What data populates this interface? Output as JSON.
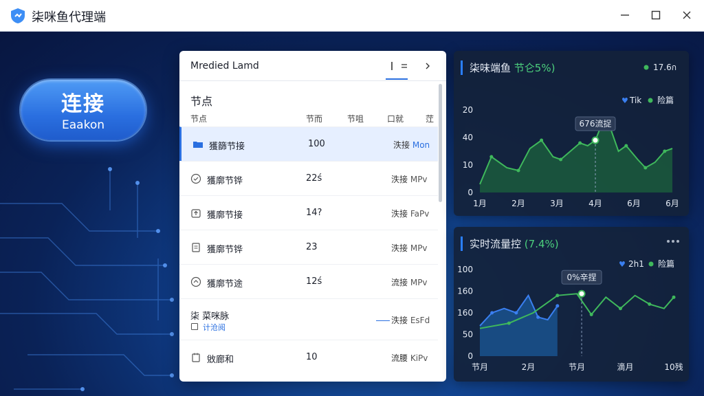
{
  "app": {
    "title": "柒咪鱼代理端",
    "icon": "shield-app-icon"
  },
  "window_controls": {
    "minimize": "minimize-icon",
    "maximize": "maximize-icon",
    "close": "close-icon"
  },
  "connect": {
    "label": "连接",
    "sublabel": "Eaakon"
  },
  "node_panel": {
    "title": "Mredied Lamd",
    "tab_icons": [
      "list-icon",
      "menu-icon",
      "chevron-right-icon"
    ],
    "section_title": "节点",
    "columns": [
      "节点",
      "节而",
      "节咀",
      "口就",
      "茳"
    ],
    "rows": [
      {
        "icon": "folder-icon",
        "name": "獲篩节接",
        "value": "100",
        "status": "泆接",
        "status_extra": "Mon"
      },
      {
        "icon": "check-circle-icon",
        "name": "獲廓节铧",
        "value": "22ś",
        "status": "泆接",
        "status_extra": "MPv"
      },
      {
        "icon": "upload-icon",
        "name": "獲廓节接",
        "value": "14?",
        "status": "泆接",
        "status_extra": "FaPv"
      },
      {
        "icon": "document-icon",
        "name": "獲廓节铧",
        "value": "23",
        "status": "泆接",
        "status_extra": "MPv"
      },
      {
        "icon": "refresh-icon",
        "name": "獲廓节途",
        "value": "12ś",
        "status": "流接",
        "status_extra": "MPv"
      },
      {
        "icon": "tag-icon",
        "name": "柒 菜咪脉",
        "name_sub": "计沧阅",
        "value": "",
        "status": "泆接",
        "status_extra": "EsFd"
      },
      {
        "icon": "calendar-icon",
        "name": "敓廊和",
        "value": "10",
        "status": "流腰",
        "status_extra": "KiPv"
      }
    ]
  },
  "chart_top": {
    "title": "柒味端鱼",
    "pct": "节仑5%)",
    "legend_top": "17.6ก",
    "tooltip": "676流捉",
    "legend_series": [
      "Tik",
      "险篇"
    ],
    "colors": {
      "line": "#3fb85c",
      "fill": "#1f7a3c"
    }
  },
  "chart_bottom": {
    "title": "实时流量控",
    "pct": "(7.4%)",
    "more": "more-icon",
    "tooltip": "0%辛捏",
    "legend_series": [
      "2h1",
      "险篇"
    ],
    "colors": {
      "blue": "#3a7ff0",
      "green": "#3fb85c"
    }
  },
  "chart_data": [
    {
      "type": "area",
      "title": "柒味端鱼 节仑5%)",
      "categories": [
        "1月",
        "2月",
        "3月",
        "4月",
        "6月",
        "6月"
      ],
      "yticks": [
        "0",
        "10",
        "40",
        "20"
      ],
      "ylim": [
        0,
        30
      ],
      "series": [
        {
          "x": [
            0,
            0.3,
            0.7,
            1.0,
            1.3,
            1.6,
            1.9,
            2.1,
            2.35,
            2.6,
            2.8,
            3.0,
            3.2,
            3.4,
            3.6,
            3.8,
            4.1,
            4.3,
            4.55,
            4.8,
            5.0
          ],
          "values": [
            3,
            13,
            9,
            8,
            16,
            19,
            13,
            12,
            15,
            18,
            17,
            19,
            26,
            23,
            15,
            17,
            12,
            9,
            11,
            15,
            16
          ]
        }
      ],
      "highlight": {
        "x": 3.0,
        "y": 19
      }
    },
    {
      "type": "line",
      "title": "实时流量控 (7.4%)",
      "categories": [
        "节月",
        "2月",
        "节月",
        "滴月",
        "10残"
      ],
      "yticks": [
        "0",
        "50",
        "160",
        "160",
        "100"
      ],
      "ylim": [
        0,
        100
      ],
      "series": [
        {
          "name": "2h1",
          "x": [
            0,
            0.25,
            0.5,
            0.75,
            1.0,
            1.2,
            1.4,
            1.6
          ],
          "values": [
            35,
            50,
            55,
            50,
            70,
            45,
            42,
            58
          ]
        },
        {
          "name": "险篇",
          "x": [
            0,
            0.6,
            1.1,
            1.6,
            2.0,
            2.3,
            2.6,
            2.9,
            3.2,
            3.5,
            3.8,
            4.0
          ],
          "values": [
            32,
            38,
            50,
            70,
            72,
            48,
            68,
            55,
            70,
            60,
            55,
            68
          ]
        }
      ],
      "highlight": {
        "x": 2.1,
        "y": 72
      }
    }
  ]
}
